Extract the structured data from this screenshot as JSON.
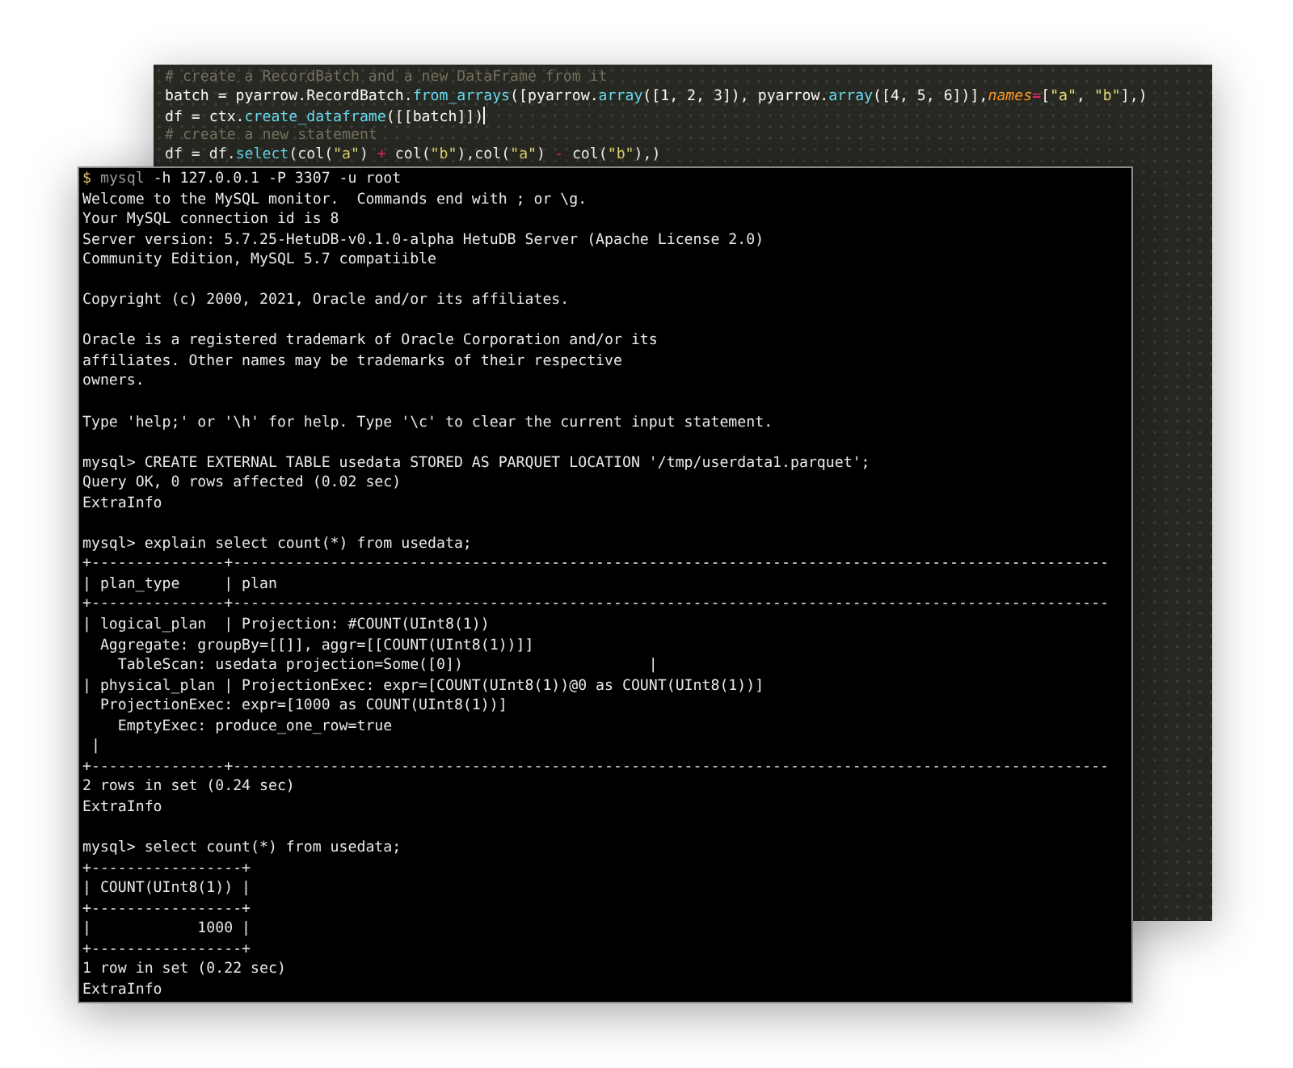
{
  "editor": {
    "lines": [
      [
        {
          "kind": "comment",
          "text": "# create a RecordBatch and a new DataFrame from it"
        }
      ],
      [
        {
          "kind": "plain",
          "text": "batch = pyarrow.RecordBatch."
        },
        {
          "kind": "func",
          "text": "from_arrays"
        },
        {
          "kind": "plain",
          "text": "([pyarrow."
        },
        {
          "kind": "func",
          "text": "array"
        },
        {
          "kind": "plain",
          "text": "([1, 2, 3]), pyarrow."
        },
        {
          "kind": "func",
          "text": "array"
        },
        {
          "kind": "plain",
          "text": "([4, 5, 6])],"
        },
        {
          "kind": "param",
          "text": "names"
        },
        {
          "kind": "op",
          "text": "="
        },
        {
          "kind": "plain",
          "text": "["
        },
        {
          "kind": "string",
          "text": "\"a\""
        },
        {
          "kind": "plain",
          "text": ", "
        },
        {
          "kind": "string",
          "text": "\"b\""
        },
        {
          "kind": "plain",
          "text": "],)"
        }
      ],
      [
        {
          "kind": "plain",
          "text": "df = ctx."
        },
        {
          "kind": "func",
          "text": "create_dataframe"
        },
        {
          "kind": "plain",
          "text": "([[batch]])"
        },
        {
          "kind": "cursor"
        }
      ],
      [
        {
          "kind": "comment",
          "text": "# create a new statement"
        }
      ],
      [
        {
          "kind": "plain",
          "text": "df = df."
        },
        {
          "kind": "func",
          "text": "select"
        },
        {
          "kind": "plain",
          "text": "(col("
        },
        {
          "kind": "string",
          "text": "\"a\""
        },
        {
          "kind": "plain",
          "text": ") "
        },
        {
          "kind": "op",
          "text": "+"
        },
        {
          "kind": "plain",
          "text": " col("
        },
        {
          "kind": "string",
          "text": "\"b\""
        },
        {
          "kind": "plain",
          "text": "),col("
        },
        {
          "kind": "string",
          "text": "\"a\""
        },
        {
          "kind": "plain",
          "text": ") "
        },
        {
          "kind": "op",
          "text": "-"
        },
        {
          "kind": "plain",
          "text": " col("
        },
        {
          "kind": "string",
          "text": "\"b\""
        },
        {
          "kind": "plain",
          "text": "),)"
        }
      ]
    ]
  },
  "terminal": {
    "command": {
      "prompt": "$",
      "program": "mysql",
      "args": "-h 127.0.0.1 -P 3307 -u root"
    },
    "blocks": [
      [
        "Welcome to the MySQL monitor.  Commands end with ; or \\g.",
        "Your MySQL connection id is 8",
        "Server version: 5.7.25-HetuDB-v0.1.0-alpha HetuDB Server (Apache License 2.0)",
        "Community Edition, MySQL 5.7 compatiible"
      ],
      [
        "Copyright (c) 2000, 2021, Oracle and/or its affiliates."
      ],
      [
        "Oracle is a registered trademark of Oracle Corporation and/or its",
        "affiliates. Other names may be trademarks of their respective",
        "owners."
      ],
      [
        "Type 'help;' or '\\h' for help. Type '\\c' to clear the current input statement."
      ],
      [
        "mysql> CREATE EXTERNAL TABLE usedata STORED AS PARQUET LOCATION '/tmp/userdata1.parquet';",
        "Query OK, 0 rows affected (0.02 sec)",
        "ExtraInfo"
      ],
      [
        "mysql> explain select count(*) from usedata;",
        "+---------------+---------------------------------------------------------------------------------------------------",
        "| plan_type     | plan",
        "+---------------+---------------------------------------------------------------------------------------------------",
        "| logical_plan  | Projection: #COUNT(UInt8(1))",
        "  Aggregate: groupBy=[[]], aggr=[[COUNT(UInt8(1))]]",
        "    TableScan: usedata projection=Some([0])                     |",
        "| physical_plan | ProjectionExec: expr=[COUNT(UInt8(1))@0 as COUNT(UInt8(1))]",
        "  ProjectionExec: expr=[1000 as COUNT(UInt8(1))]",
        "    EmptyExec: produce_one_row=true",
        " |",
        "+---------------+---------------------------------------------------------------------------------------------------",
        "2 rows in set (0.24 sec)",
        "ExtraInfo"
      ],
      [
        "mysql> select count(*) from usedata;",
        "+-----------------+",
        "| COUNT(UInt8(1)) |",
        "+-----------------+",
        "|            1000 |",
        "+-----------------+",
        "1 row in set (0.22 sec)",
        "ExtraInfo"
      ]
    ]
  }
}
